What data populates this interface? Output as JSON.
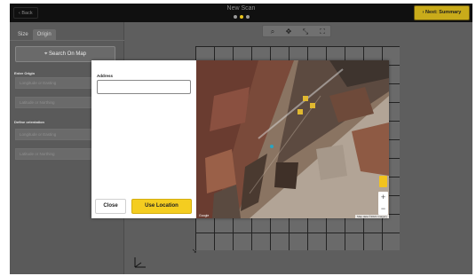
{
  "topbar": {
    "back_label": "Back",
    "title": "New Scan",
    "next_label": "Next: Summary"
  },
  "step_dots": {
    "colors": [
      "#9a9a9a",
      "#e8c31c",
      "#9a9a9a"
    ]
  },
  "tabs": [
    {
      "label": "Size"
    },
    {
      "label": "Origin"
    }
  ],
  "sidebar": {
    "search_map_label": "Search On Map",
    "enter_origin_label": "Enter Origin",
    "origin_fields": [
      {
        "placeholder": "Longitude or Easting"
      },
      {
        "placeholder": "Latitude or Northing"
      }
    ],
    "orientation_label": "Define orientation",
    "orientation_fields": [
      {
        "placeholder": "Longitude or Easting"
      },
      {
        "placeholder": "Latitude or Northing"
      }
    ]
  },
  "toolbar": {
    "icons": [
      "search-icon",
      "move-icon",
      "fit-icon",
      "fullscreen-icon"
    ]
  },
  "dialog": {
    "address_label": "Address",
    "address_value": "",
    "close_label": "Close",
    "use_location_label": "Use Location"
  },
  "map": {
    "google_label": "Google",
    "attribution": "Map data ©2021 Imagery",
    "zoom_in": "+",
    "zoom_out": "−"
  },
  "colors": {
    "accent": "#f4cd20",
    "topbar": "#101010",
    "canvas": "#5e5e5e"
  }
}
